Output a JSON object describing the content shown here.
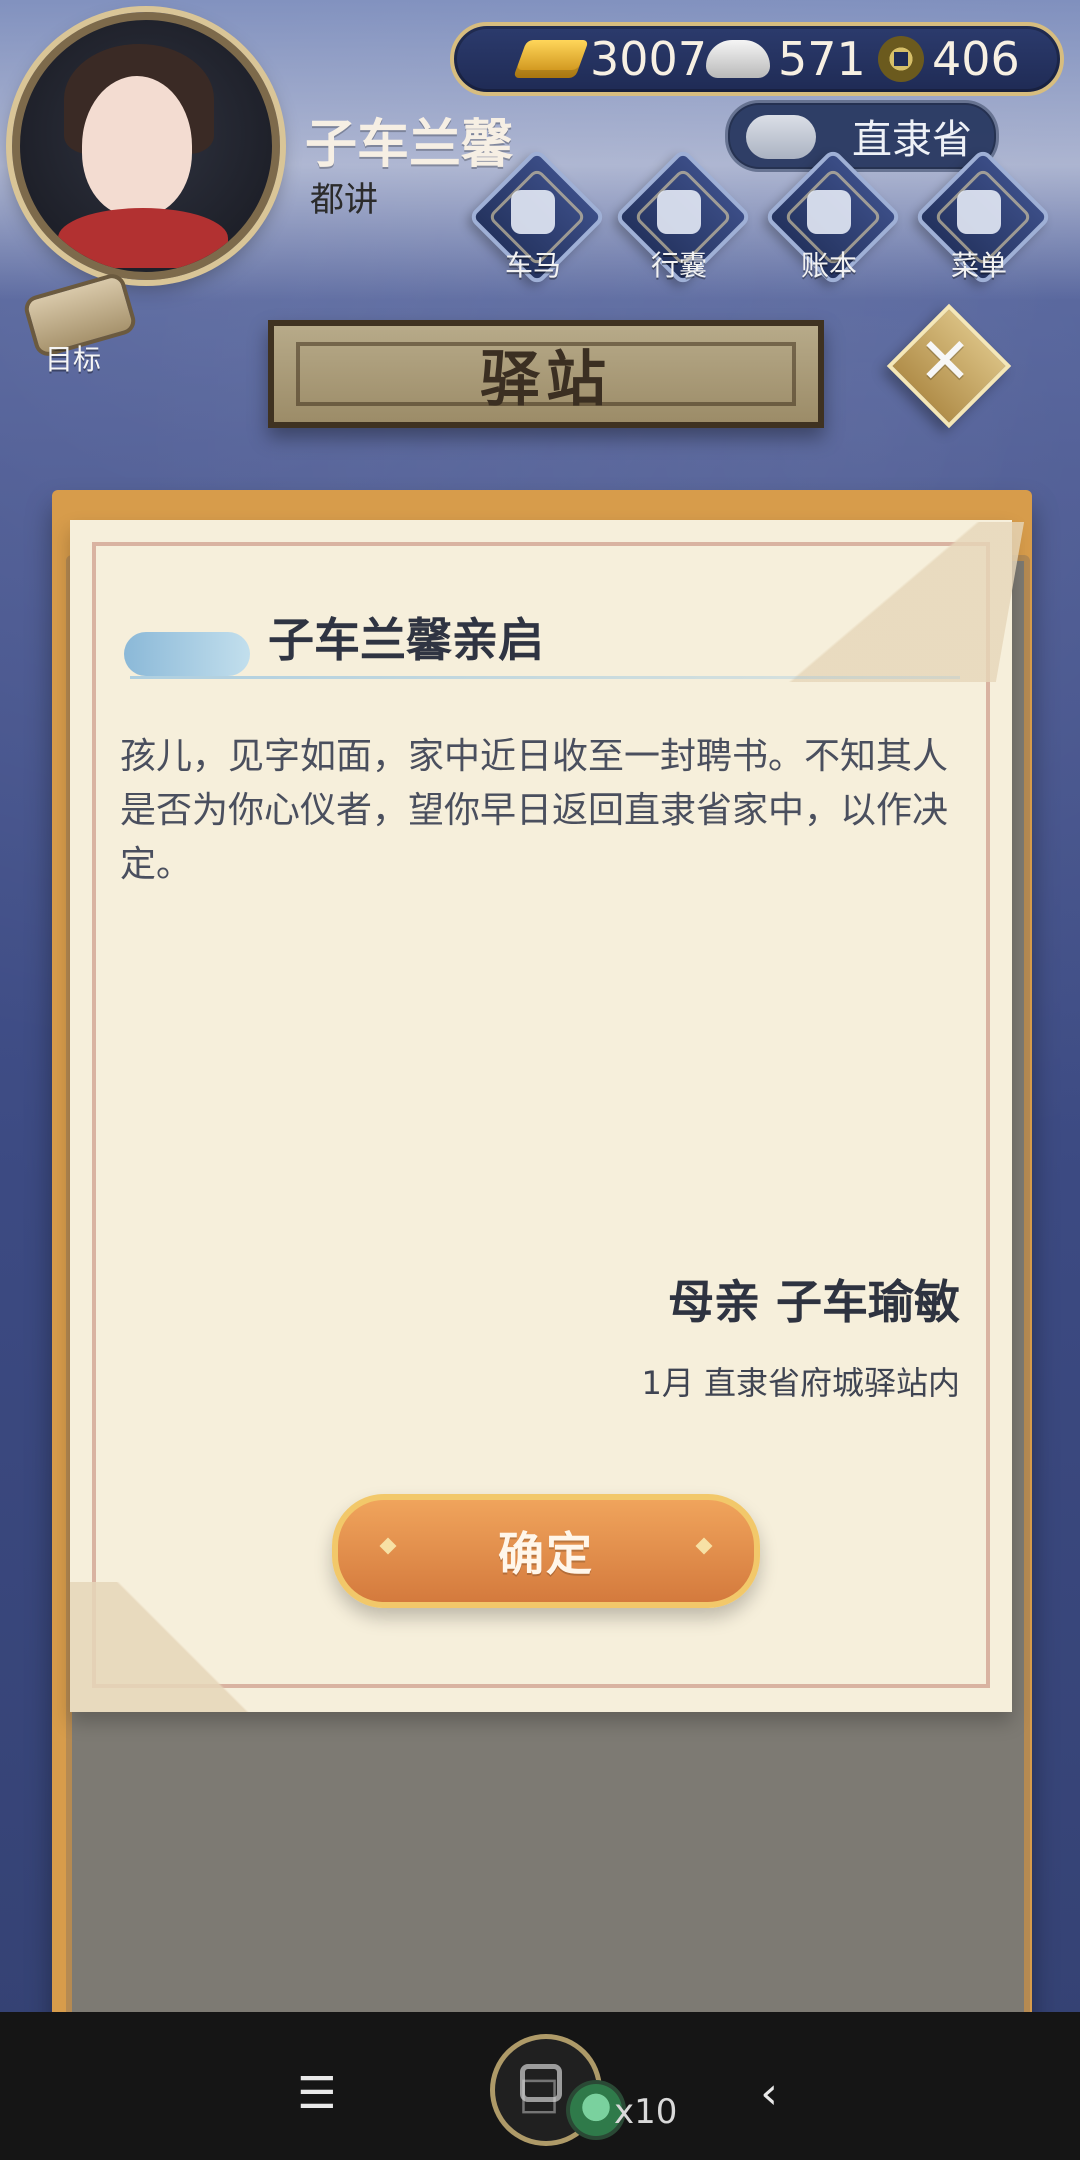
{
  "hud": {
    "currencies": [
      {
        "icon": "gold-ingot-icon",
        "value": "3007"
      },
      {
        "icon": "silver-ingot-icon",
        "value": "571"
      },
      {
        "icon": "copper-coin-icon",
        "value": "406"
      }
    ],
    "location": "直隶省",
    "player": {
      "name": "子车兰馨",
      "title": "都讲"
    },
    "buttons": [
      {
        "label": "车马",
        "icon": "carriage-icon"
      },
      {
        "label": "行囊",
        "icon": "bag-icon"
      },
      {
        "label": "账本",
        "icon": "ledger-icon"
      },
      {
        "label": "菜单",
        "icon": "menu-icon"
      }
    ],
    "goal_label": "目标"
  },
  "station": {
    "title": "驿站"
  },
  "letter": {
    "heading": "子车兰馨亲启",
    "body": "孩儿，见字如面，家中近日收至一封聘书。不知其人是否为你心仪者，望你早日返回直隶省家中，以作决定。",
    "signature": "母亲 子车瑜敏",
    "place_date": "1月 直隶省府城驿站内",
    "confirm_label": "确定"
  },
  "system_bar": {
    "badge": "x10"
  },
  "colors": {
    "panel_orange": "#d79c4b",
    "button_orange": "#d47a3d",
    "paper": "#f6efdb",
    "text_dark": "#2f3442"
  }
}
